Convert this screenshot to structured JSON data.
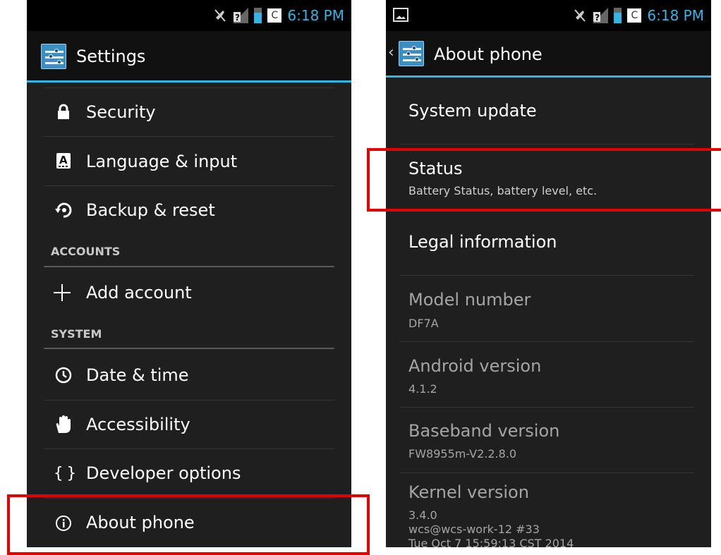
{
  "status_bar": {
    "time": "6:18 PM",
    "carrier_letter": "C",
    "icons": [
      "mute-icon",
      "no-sim-signal-icon",
      "battery-icon",
      "c-badge-icon"
    ],
    "accent": "#33b5e5"
  },
  "settings": {
    "title": "Settings",
    "items_top": [
      {
        "label": "Security",
        "icon": "lock-icon"
      },
      {
        "label": "Language & input",
        "icon": "keyboard-a-icon"
      },
      {
        "label": "Backup & reset",
        "icon": "backup-reset-icon"
      }
    ],
    "accounts_header": "ACCOUNTS",
    "add_account": "Add account",
    "system_header": "SYSTEM",
    "items_system": [
      {
        "label": "Date & time",
        "icon": "clock-icon"
      },
      {
        "label": "Accessibility",
        "icon": "hand-icon"
      },
      {
        "label": "Developer options",
        "icon": "braces-icon"
      },
      {
        "label": "About phone",
        "icon": "info-icon"
      }
    ]
  },
  "about_phone": {
    "title": "About phone",
    "system_update": "System update",
    "status": {
      "title": "Status",
      "subtitle": "Battery Status, battery level, etc."
    },
    "legal": "Legal information",
    "model": {
      "title": "Model number",
      "value": "DF7A"
    },
    "android": {
      "title": "Android version",
      "value": "4.1.2"
    },
    "baseband": {
      "title": "Baseband version",
      "value": "FW8955m-V2.2.8.0"
    },
    "kernel": {
      "title": "Kernel version",
      "line1": "3.4.0",
      "line2": "wcs@wcs-work-12 #33",
      "line3": "Tue Oct 7 15:59:13 CST 2014"
    }
  },
  "highlight_color": "#e60000"
}
